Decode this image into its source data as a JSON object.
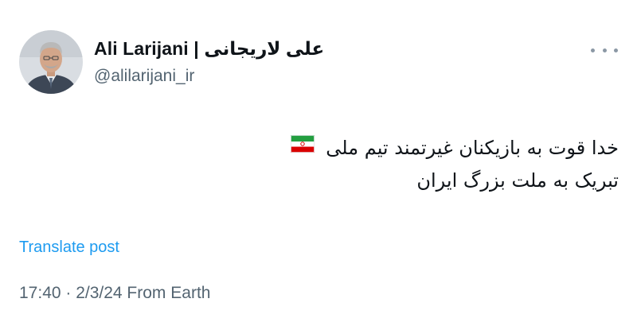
{
  "author": {
    "display_name": "Ali Larijani | علی لاریجانی",
    "handle": "@alilarijani_ir",
    "avatar_icon": "profile-photo"
  },
  "post": {
    "line1": "خدا قوت به بازیکنان غیرتمند تیم ملی",
    "line2": "تبریک به ملت بزرگ ایران",
    "emoji_icon": "iran-flag"
  },
  "actions": {
    "translate_label": "Translate post",
    "more_icon": "more-horizontal-icon"
  },
  "meta": {
    "timestamp": "17:40 · 2/3/24 From Earth"
  },
  "colors": {
    "primary_text": "#0f1419",
    "secondary_text": "#536471",
    "link": "#1d9bf0"
  }
}
